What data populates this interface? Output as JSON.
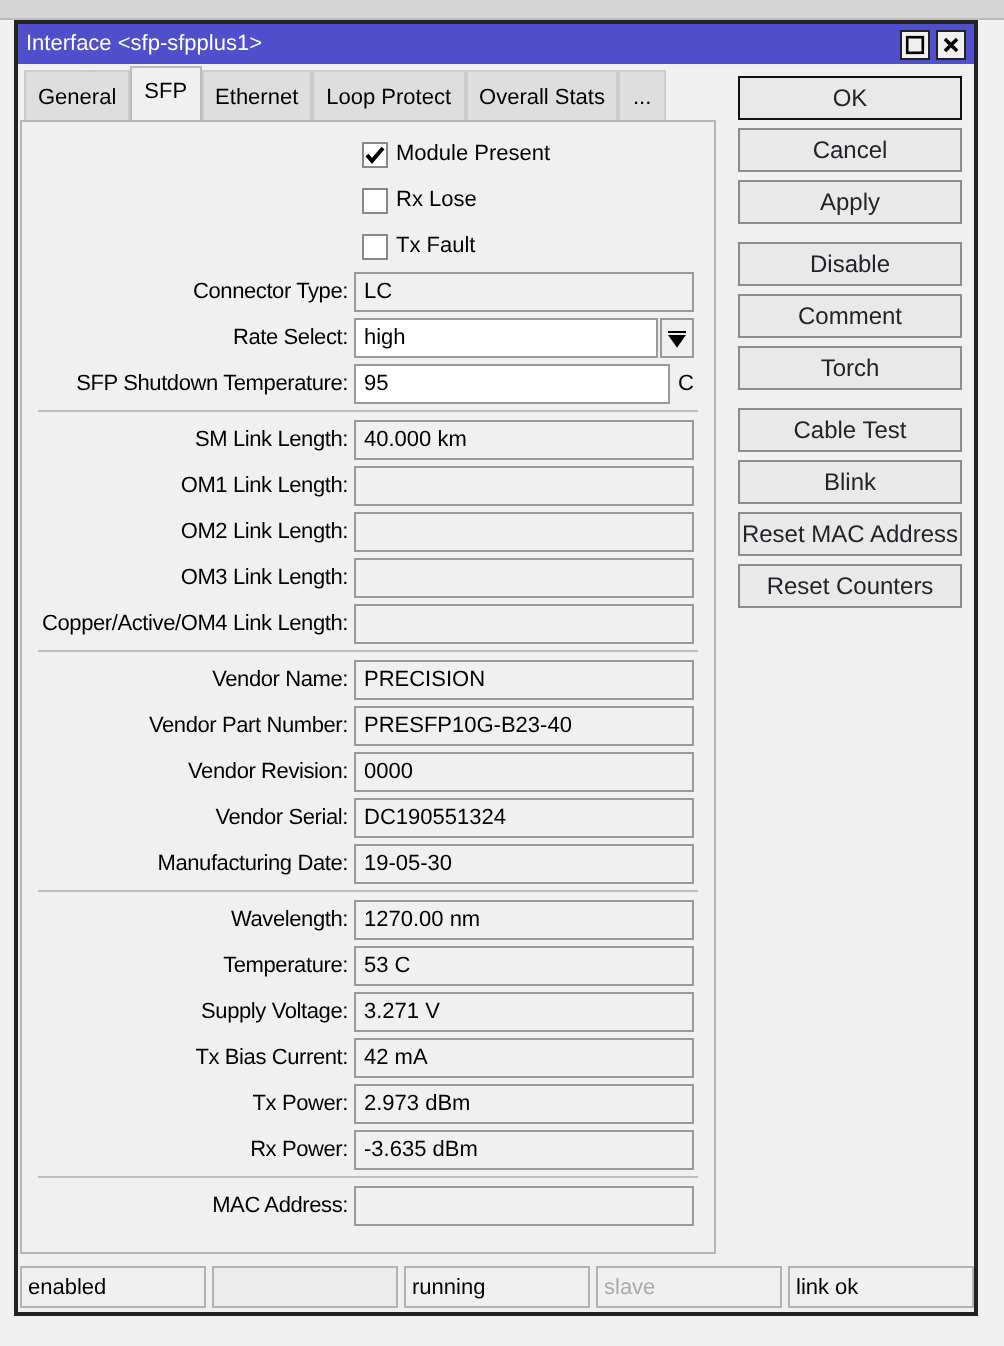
{
  "window": {
    "title": "Interface <sfp-sfpplus1>"
  },
  "tabs": [
    {
      "label": "General",
      "selected": false
    },
    {
      "label": "SFP",
      "selected": true
    },
    {
      "label": "Ethernet",
      "selected": false
    },
    {
      "label": "Loop Protect",
      "selected": false
    },
    {
      "label": "Overall Stats",
      "selected": false
    },
    {
      "label": "...",
      "selected": false
    }
  ],
  "checkboxes": [
    {
      "label": "Module Present",
      "checked": true
    },
    {
      "label": "Rx Lose",
      "checked": false
    },
    {
      "label": "Tx Fault",
      "checked": false
    }
  ],
  "sections": [
    [
      {
        "kind": "readonly",
        "label": "Connector Type:",
        "value": "LC"
      },
      {
        "kind": "select",
        "label": "Rate Select:",
        "value": "high"
      },
      {
        "kind": "input",
        "label": "SFP Shutdown Temperature:",
        "value": "95",
        "unit": "C"
      }
    ],
    [
      {
        "kind": "readonly",
        "label": "SM Link Length:",
        "value": "40.000 km"
      },
      {
        "kind": "readonly",
        "label": "OM1 Link Length:"
      },
      {
        "kind": "readonly",
        "label": "OM2 Link Length:"
      },
      {
        "kind": "readonly",
        "label": "OM3 Link Length:"
      },
      {
        "kind": "readonly",
        "label": "Copper/Active/OM4 Link Length:"
      }
    ],
    [
      {
        "kind": "readonly",
        "label": "Vendor Name:",
        "value": "PRECISION"
      },
      {
        "kind": "readonly",
        "label": "Vendor Part Number:",
        "value": "PRESFP10G-B23-40"
      },
      {
        "kind": "readonly",
        "label": "Vendor Revision:",
        "value": "0000"
      },
      {
        "kind": "readonly",
        "label": "Vendor Serial:",
        "value": "DC190551324"
      },
      {
        "kind": "readonly",
        "label": "Manufacturing Date:",
        "value": "19-05-30"
      }
    ],
    [
      {
        "kind": "readonly",
        "label": "Wavelength:",
        "value": "1270.00 nm"
      },
      {
        "kind": "readonly",
        "label": "Temperature:",
        "value": "53 C"
      },
      {
        "kind": "readonly",
        "label": "Supply Voltage:",
        "value": "3.271 V"
      },
      {
        "kind": "readonly",
        "label": "Tx Bias Current:",
        "value": "42 mA"
      },
      {
        "kind": "readonly",
        "label": "Tx Power:",
        "value": "2.973 dBm"
      },
      {
        "kind": "readonly",
        "label": "Rx Power:",
        "value": "-3.635 dBm"
      }
    ],
    [
      {
        "kind": "readonly",
        "label": "MAC Address:"
      }
    ]
  ],
  "button_groups": [
    [
      {
        "label": "OK",
        "default": true
      },
      {
        "label": "Cancel",
        "default": false
      },
      {
        "label": "Apply",
        "default": false
      }
    ],
    [
      {
        "label": "Disable",
        "default": false
      },
      {
        "label": "Comment",
        "default": false
      },
      {
        "label": "Torch",
        "default": false
      }
    ],
    [
      {
        "label": "Cable Test",
        "default": false
      },
      {
        "label": "Blink",
        "default": false
      },
      {
        "label": "Reset MAC Address",
        "default": false
      },
      {
        "label": "Reset Counters",
        "default": false
      }
    ]
  ],
  "status_bar": [
    {
      "kind": "text",
      "text": "enabled",
      "disabled": false
    },
    {
      "kind": "blank"
    },
    {
      "kind": "text",
      "text": "running",
      "disabled": false
    },
    {
      "kind": "text",
      "text": "slave",
      "disabled": true
    },
    {
      "kind": "text",
      "text": "link ok",
      "disabled": false
    }
  ]
}
